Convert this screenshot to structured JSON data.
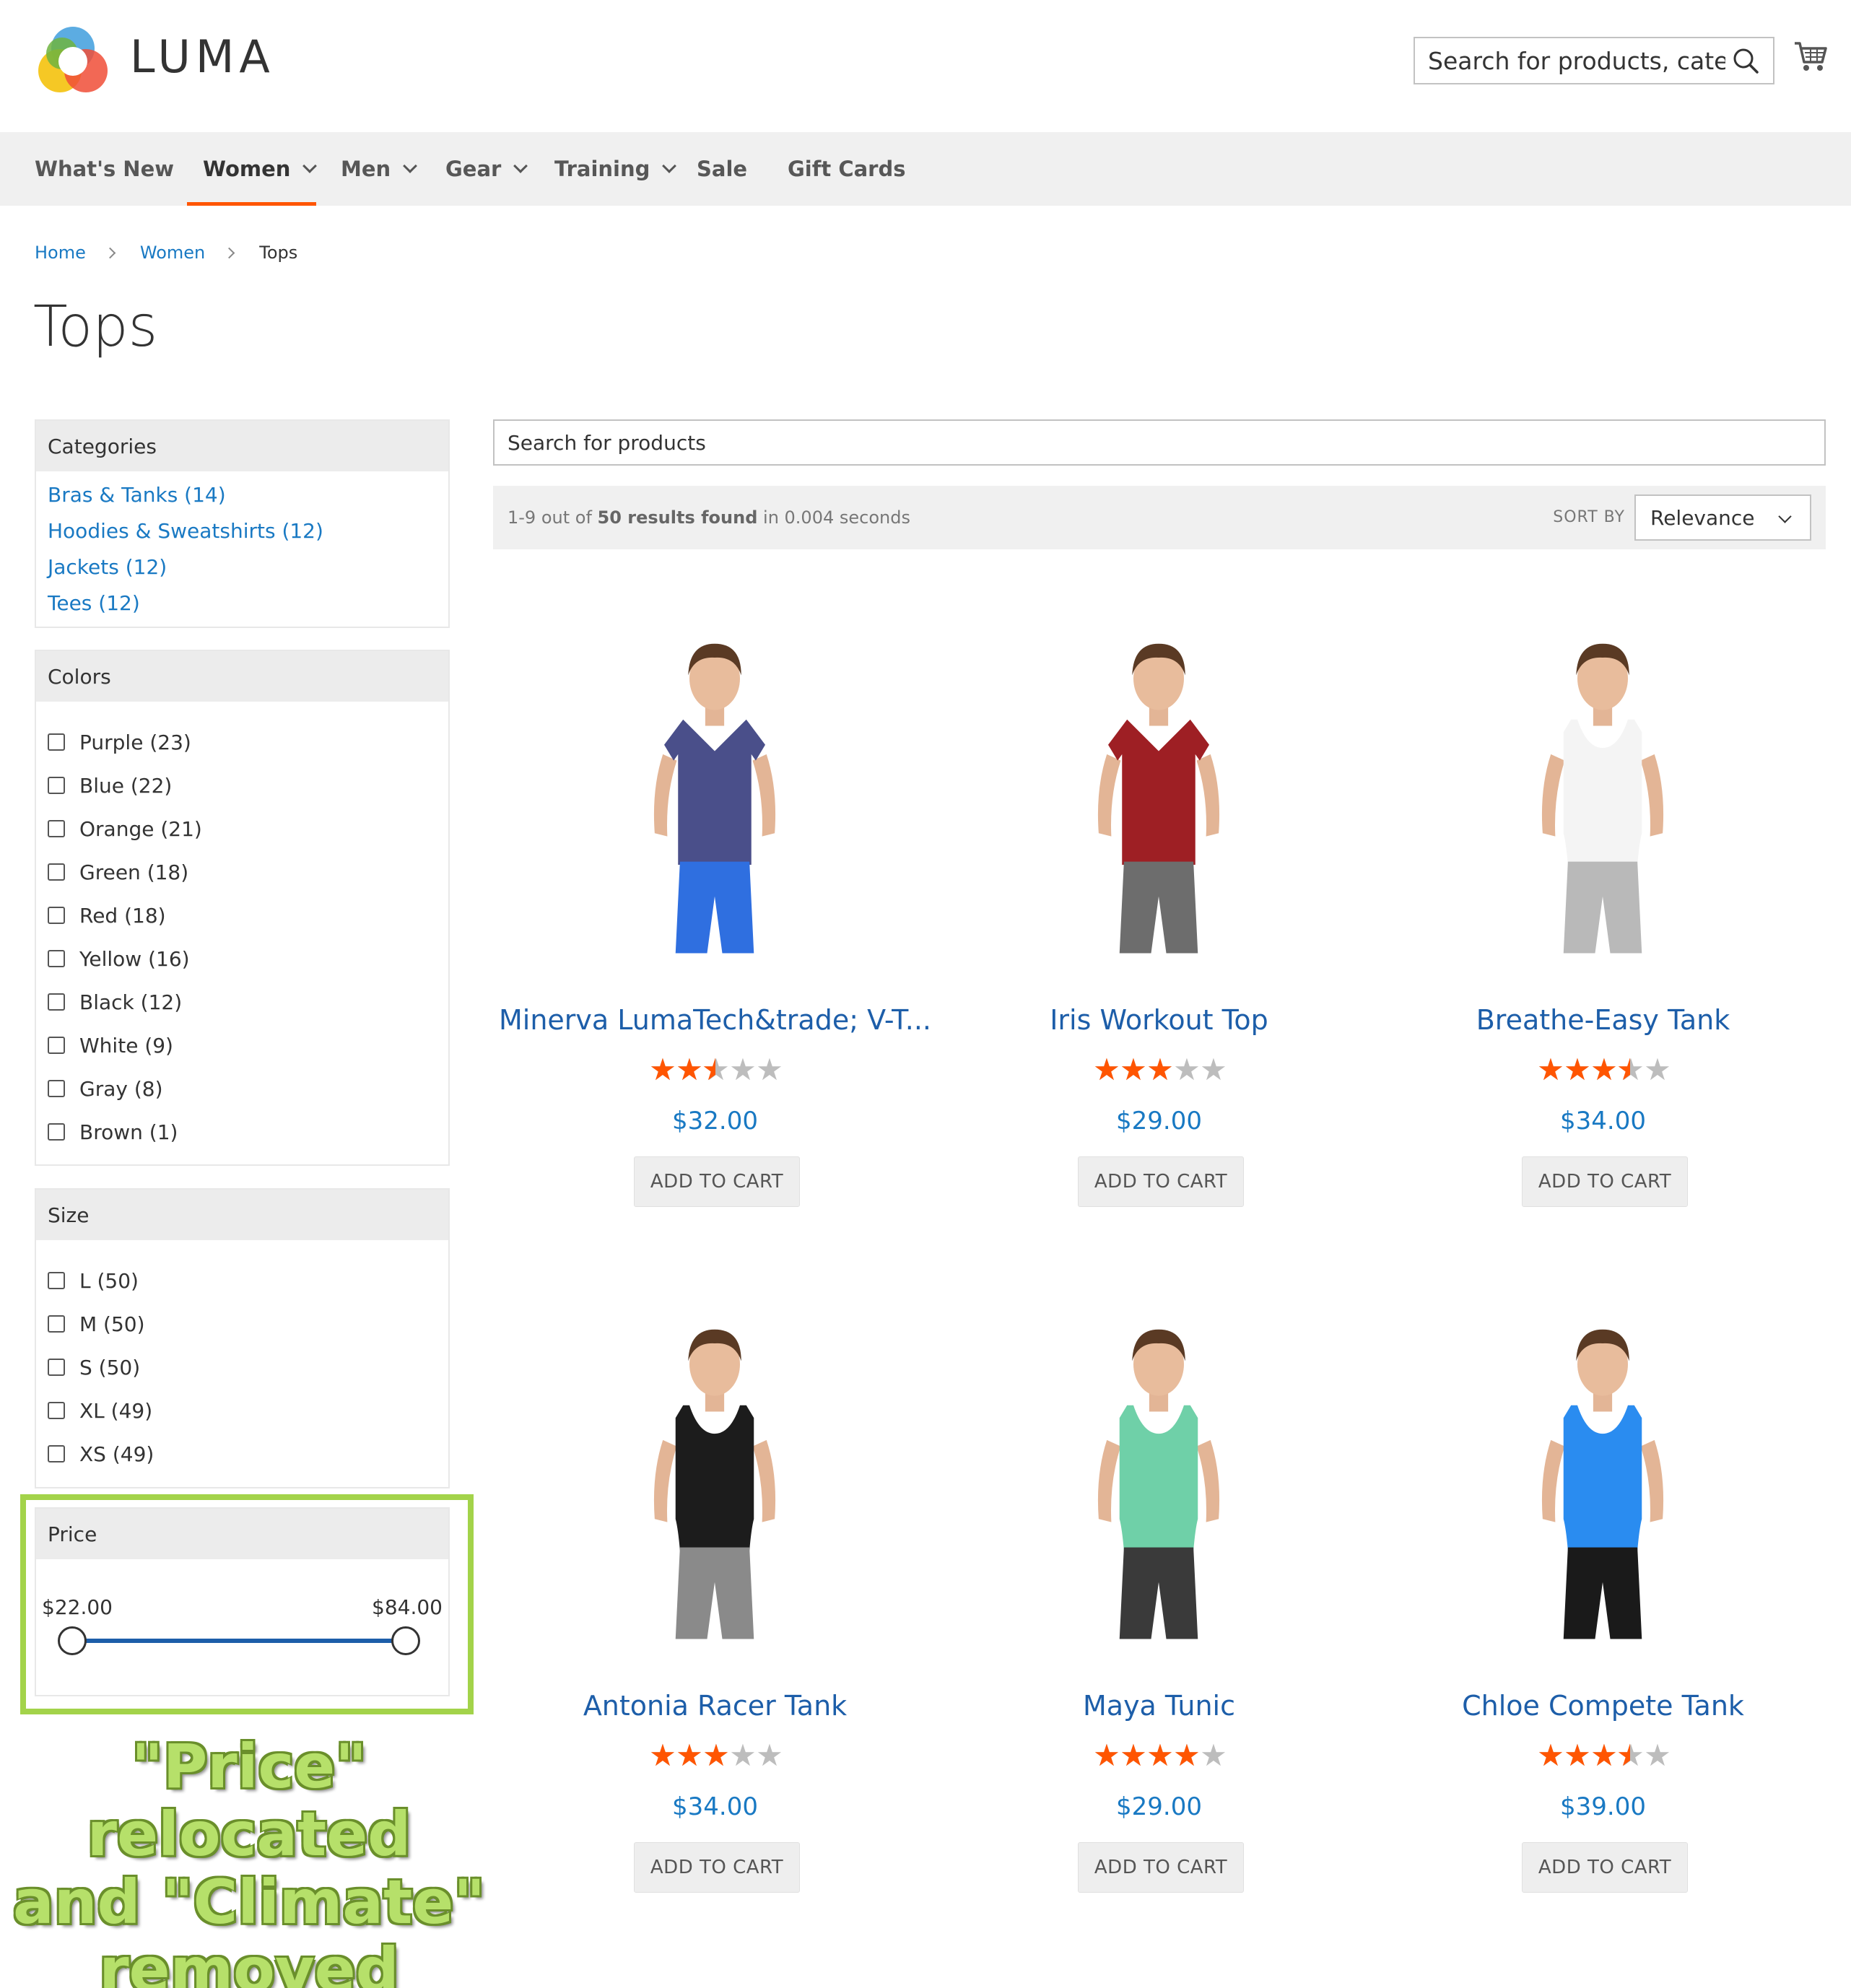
{
  "brand": {
    "name": "LUMA",
    "colors": {
      "accent": "#ff5501",
      "link": "#1979c3",
      "slider": "#1d5ea9",
      "annotation": "#a3d34a"
    }
  },
  "header": {
    "search_placeholder": "Search for products, catego",
    "search_icon": "search-icon",
    "cart_icon": "cart-icon"
  },
  "nav": {
    "items": [
      {
        "label": "What's New",
        "has_dropdown": false,
        "active": false
      },
      {
        "label": "Women",
        "has_dropdown": true,
        "active": true
      },
      {
        "label": "Men",
        "has_dropdown": true,
        "active": false
      },
      {
        "label": "Gear",
        "has_dropdown": true,
        "active": false
      },
      {
        "label": "Training",
        "has_dropdown": true,
        "active": false
      },
      {
        "label": "Sale",
        "has_dropdown": false,
        "active": false
      },
      {
        "label": "Gift Cards",
        "has_dropdown": false,
        "active": false
      }
    ]
  },
  "breadcrumb": {
    "home": "Home",
    "women": "Women",
    "current": "Tops"
  },
  "page_title": "Tops",
  "filters": {
    "categories": {
      "title": "Categories",
      "items": [
        "Bras & Tanks (14)",
        "Hoodies & Sweatshirts (12)",
        "Jackets (12)",
        "Tees (12)"
      ]
    },
    "colors": {
      "title": "Colors",
      "items": [
        "Purple (23)",
        "Blue (22)",
        "Orange (21)",
        "Green (18)",
        "Red (18)",
        "Yellow (16)",
        "Black (12)",
        "White (9)",
        "Gray (8)",
        "Brown (1)"
      ]
    },
    "size": {
      "title": "Size",
      "items": [
        "L (50)",
        "M (50)",
        "S (50)",
        "XL (49)",
        "XS (49)"
      ]
    },
    "price": {
      "title": "Price",
      "min_label": "$22.00",
      "max_label": "$84.00",
      "range_start_fraction": 0.0,
      "range_end_fraction": 1.0
    }
  },
  "annotation": {
    "line1": "\"Price\" relocated",
    "line2": "and \"Climate\"",
    "line3": "removed"
  },
  "product_search": {
    "placeholder": "Search for products"
  },
  "toolbar": {
    "results_prefix": "1-9 out of ",
    "results_count": "50 results found",
    "results_suffix": " in 0.004 seconds",
    "sort_label": "SORT BY",
    "sort_value": "Relevance"
  },
  "products": [
    {
      "name": "Minerva LumaTech&trade; V-T...",
      "rating": 2.5,
      "price": "$32.00",
      "button": "ADD TO CART",
      "shirt": "#4a4f8a",
      "bottom": "#2f6fe0",
      "style": "tee"
    },
    {
      "name": "Iris Workout Top",
      "rating": 3,
      "price": "$29.00",
      "button": "ADD TO CART",
      "shirt": "#9e1f24",
      "bottom": "#6d6d6d",
      "style": "tee"
    },
    {
      "name": "Breathe-Easy Tank",
      "rating": 3.5,
      "price": "$34.00",
      "button": "ADD TO CART",
      "shirt": "#f4f4f4",
      "bottom": "#b9b9b9",
      "style": "tank"
    },
    {
      "name": "Antonia Racer Tank",
      "rating": 3,
      "price": "$34.00",
      "button": "ADD TO CART",
      "shirt": "#1c1c1c",
      "bottom": "#8a8a8a",
      "style": "tank"
    },
    {
      "name": "Maya Tunic",
      "rating": 4,
      "price": "$29.00",
      "button": "ADD TO CART",
      "shirt": "#6fd0a8",
      "bottom": "#3a3a3a",
      "style": "tank"
    },
    {
      "name": "Chloe Compete Tank",
      "rating": 3.5,
      "price": "$39.00",
      "button": "ADD TO CART",
      "shirt": "#2a8cf0",
      "bottom": "#1a1a1a",
      "style": "tank"
    }
  ]
}
